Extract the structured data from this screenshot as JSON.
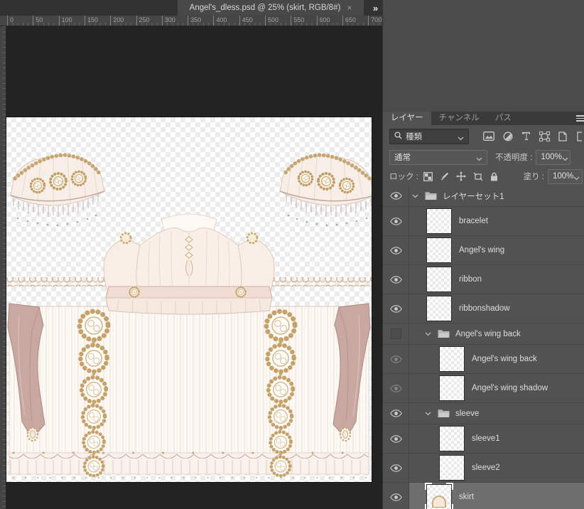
{
  "window": {
    "doc_tab": {
      "title": "Angel's_dless.psd @ 25% (skirt, RGB/8#)",
      "close_label": "×",
      "overflow_label": "»"
    },
    "ruler_labels": [
      "0",
      "50",
      "100",
      "150",
      "200",
      "250",
      "300",
      "350",
      "400",
      "450",
      "500",
      "550",
      "600",
      "650",
      "700"
    ]
  },
  "layers_panel": {
    "tabs": [
      {
        "id": "layers",
        "label": "レイヤー",
        "active": true
      },
      {
        "id": "channels",
        "label": "チャンネル",
        "active": false
      },
      {
        "id": "paths",
        "label": "パス",
        "active": false
      }
    ],
    "filter": {
      "kind_value": "種類"
    },
    "blend": {
      "mode_value": "通常",
      "opacity_label": "不透明度 :",
      "opacity_value": "100%"
    },
    "lock": {
      "label": "ロック :",
      "fill_label": "塗り :",
      "fill_value": "100%"
    },
    "layers": [
      {
        "type": "group",
        "name": "レイヤーセット1",
        "depth": 0,
        "eye": "on",
        "expanded": true,
        "selected": false
      },
      {
        "type": "layer",
        "name": "bracelet",
        "depth": 1,
        "eye": "on",
        "selected": false
      },
      {
        "type": "layer",
        "name": "Angel's wing",
        "depth": 1,
        "eye": "on",
        "selected": false
      },
      {
        "type": "layer",
        "name": "ribbon",
        "depth": 1,
        "eye": "on",
        "selected": false
      },
      {
        "type": "layer",
        "name": "ribbonshadow",
        "depth": 1,
        "eye": "on",
        "selected": false
      },
      {
        "type": "group",
        "name": "Angel's wing back",
        "depth": 1,
        "eye": "off",
        "expanded": true,
        "selected": false
      },
      {
        "type": "layer",
        "name": "Angel's wing back",
        "depth": 2,
        "eye": "dim",
        "selected": false
      },
      {
        "type": "layer",
        "name": "Angel's wing shadow",
        "depth": 2,
        "eye": "dim",
        "selected": false
      },
      {
        "type": "group",
        "name": "sleeve",
        "depth": 1,
        "eye": "on",
        "expanded": true,
        "selected": false
      },
      {
        "type": "layer",
        "name": "sleeve1",
        "depth": 2,
        "eye": "on",
        "selected": false
      },
      {
        "type": "layer",
        "name": "sleeve2",
        "depth": 2,
        "eye": "on",
        "selected": false
      },
      {
        "type": "layer",
        "name": "skirt",
        "depth": 1,
        "eye": "on",
        "selected": true,
        "thumb": "skirt"
      }
    ]
  },
  "colors": {
    "panel_bg": "#525252",
    "panel_top_bg": "#4b4b4b",
    "tabstrip_bg": "#3a3a3a",
    "pasteboard": "#232323",
    "selected_row": "#6e6e6e",
    "accent_gold": "#c6a26b",
    "fabric_cream": "#f7efe8",
    "ribbon_mauve": "#c9a8a2"
  }
}
